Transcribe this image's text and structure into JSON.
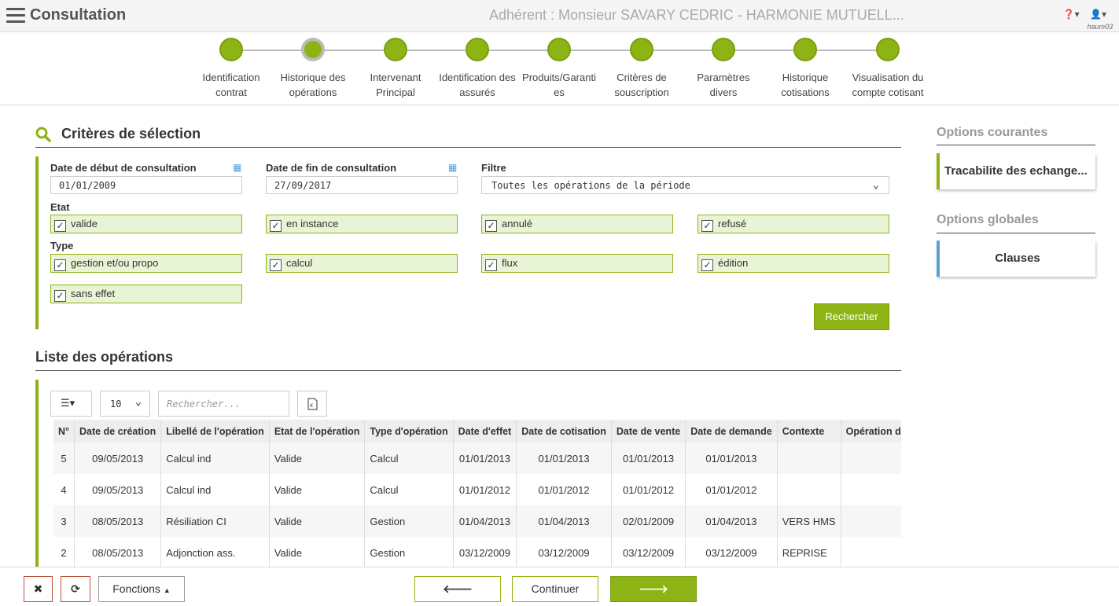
{
  "header": {
    "title": "Consultation",
    "adherent": "Adhérent : Monsieur SAVARY CEDRIC - HARMONIE MUTUELL...",
    "user": "haum03"
  },
  "steps": [
    {
      "line1": "Identification",
      "line2": "contrat"
    },
    {
      "line1": "Historique des",
      "line2": "opérations"
    },
    {
      "line1": "Intervenant",
      "line2": "Principal"
    },
    {
      "line1": "Identification des",
      "line2": "assurés"
    },
    {
      "line1": "Produits/Garanti",
      "line2": "es"
    },
    {
      "line1": "Critères de",
      "line2": "souscription"
    },
    {
      "line1": "Paramètres",
      "line2": "divers"
    },
    {
      "line1": "Historique",
      "line2": "cotisations"
    },
    {
      "line1": "Visualisation du",
      "line2": "compte cotisant"
    }
  ],
  "criteria": {
    "title": "Critères de sélection",
    "start_label": "Date de début de consultation",
    "start_value": "01/01/2009",
    "end_label": "Date de fin de consultation",
    "end_value": "27/09/2017",
    "filter_label": "Filtre",
    "filter_value": "Toutes les opérations de la période",
    "etat_label": "Etat",
    "etat": [
      "valide",
      "en instance",
      "annulé",
      "refusé"
    ],
    "type_label": "Type",
    "types": [
      "gestion et/ou propo",
      "calcul",
      "flux",
      "édition",
      "sans effet"
    ],
    "search_button": "Rechercher"
  },
  "operations": {
    "title": "Liste des opérations",
    "page_size": "10",
    "search_placeholder": "Rechercher...",
    "columns": [
      "N°",
      "Date de création",
      "Libellé de l'opération",
      "Etat de l'opération",
      "Type d'opération",
      "Date d'effet",
      "Date de cotisation",
      "Date de vente",
      "Date de demande",
      "Contexte",
      "Opération de g"
    ],
    "rows": [
      [
        "5",
        "09/05/2013",
        "Calcul ind",
        "Valide",
        "Calcul",
        "01/01/2013",
        "01/01/2013",
        "01/01/2013",
        "01/01/2013",
        "",
        ""
      ],
      [
        "4",
        "09/05/2013",
        "Calcul ind",
        "Valide",
        "Calcul",
        "01/01/2012",
        "01/01/2012",
        "01/01/2012",
        "01/01/2012",
        "",
        ""
      ],
      [
        "3",
        "08/05/2013",
        "Résiliation CI",
        "Valide",
        "Gestion",
        "01/04/2013",
        "01/04/2013",
        "02/01/2009",
        "01/04/2013",
        "VERS HMS",
        ""
      ],
      [
        "2",
        "08/05/2013",
        "Adjonction ass.",
        "Valide",
        "Gestion",
        "03/12/2009",
        "03/12/2009",
        "03/12/2009",
        "03/12/2009",
        "REPRISE",
        ""
      ]
    ]
  },
  "right_panel": {
    "current_title": "Options courantes",
    "current_item": "Tracabilite des echange...",
    "global_title": "Options globales",
    "global_item": "Clauses"
  },
  "footer": {
    "functions_label": "Fonctions",
    "continue_label": "Continuer"
  },
  "colors": {
    "accent": "#8db414",
    "accent_light": "#e9f3d5",
    "info_blue": "#5aa0d6"
  }
}
